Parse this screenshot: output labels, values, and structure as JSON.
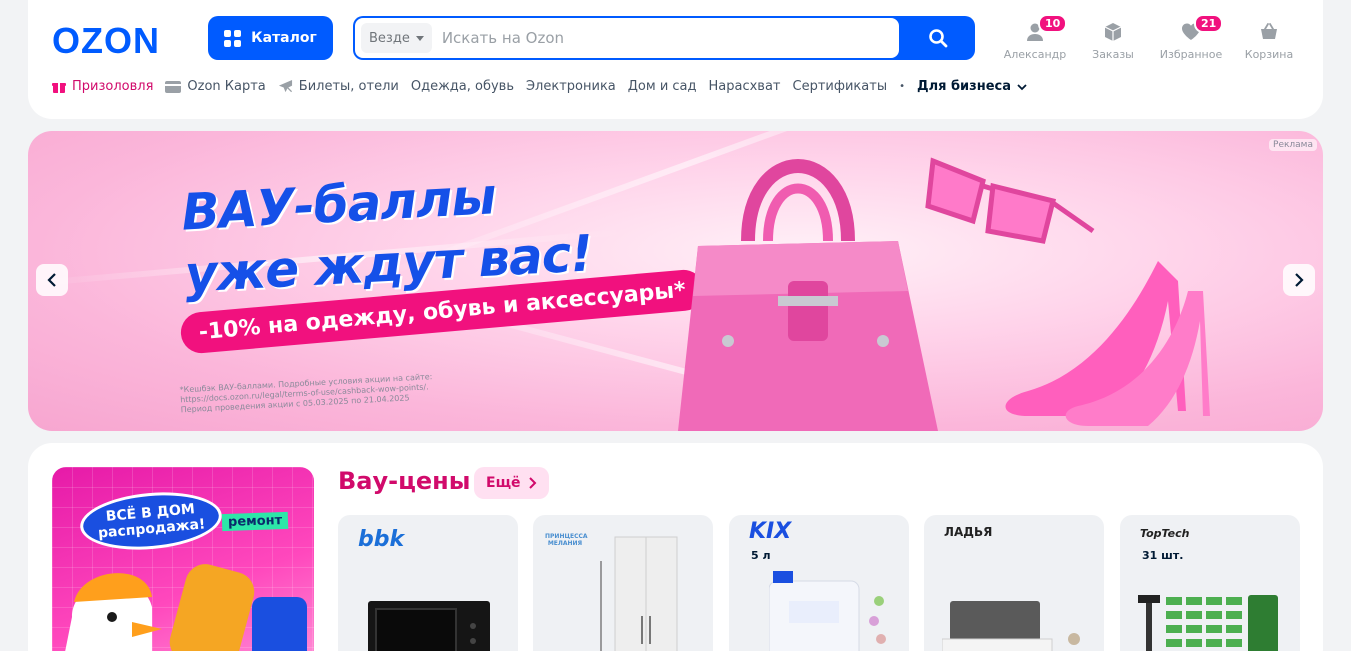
{
  "header": {
    "logo": "OZON",
    "catalog_label": "Каталог",
    "search": {
      "scope": "Везде",
      "placeholder": "Искать на Ozon"
    },
    "user_actions": [
      {
        "label": "Александр",
        "icon": "user-icon",
        "badge": "10"
      },
      {
        "label": "Заказы",
        "icon": "box-icon",
        "badge": ""
      },
      {
        "label": "Избранное",
        "icon": "heart-icon",
        "badge": "21"
      },
      {
        "label": "Корзина",
        "icon": "cart-icon",
        "badge": ""
      }
    ]
  },
  "nav": {
    "items": [
      {
        "label": "Призоловля",
        "icon": "gift-icon"
      },
      {
        "label": "Ozon Карта",
        "icon": "card-icon"
      },
      {
        "label": "Билеты, отели",
        "icon": "plane-icon"
      },
      {
        "label": "Одежда, обувь"
      },
      {
        "label": "Электроника"
      },
      {
        "label": "Дом и сад"
      },
      {
        "label": "Нарасхват"
      },
      {
        "label": "Сертификаты"
      }
    ],
    "business": "Для бизнеса"
  },
  "banner": {
    "title_line1": "ВАУ-баллы",
    "title_line2": "уже ждут вас!",
    "pill": "-10% на одежду, обувь и аксессуары*",
    "fineprint_1": "*Кешбэк ВАУ-баллами. Подробные условия акции на сайте:",
    "fineprint_2": "https://docs.ozon.ru/legal/terms-of-use/cashback-wow-points/.",
    "fineprint_3": "Период проведения акции с 05.03.2025 по 21.04.2025",
    "ad_label": "Реклама"
  },
  "promo": {
    "oval_text": "ВСЁ В ДОМ распродажа!",
    "tag": "ремонт"
  },
  "section": {
    "title": "Вау-цены",
    "more_label": "Ещё"
  },
  "products": [
    {
      "brand": "bbk",
      "note": "",
      "brand_color": "#1b6fd8"
    },
    {
      "brand": "ПРИНЦЕССА МЕЛАНИЯ",
      "note": "",
      "brand_color": "#4a8fd0"
    },
    {
      "brand": "KIX",
      "note": "5 л",
      "brand_color": "#1a4fe0"
    },
    {
      "brand": "ЛАДЬЯ",
      "note": "",
      "brand_color": "#222222"
    },
    {
      "brand": "TopTech",
      "note": "31 шт.",
      "brand_color": "#222222"
    }
  ],
  "colors": {
    "brand_blue": "#005bff",
    "accent_pink": "#f1117e",
    "title_pink": "#d10a6b"
  }
}
